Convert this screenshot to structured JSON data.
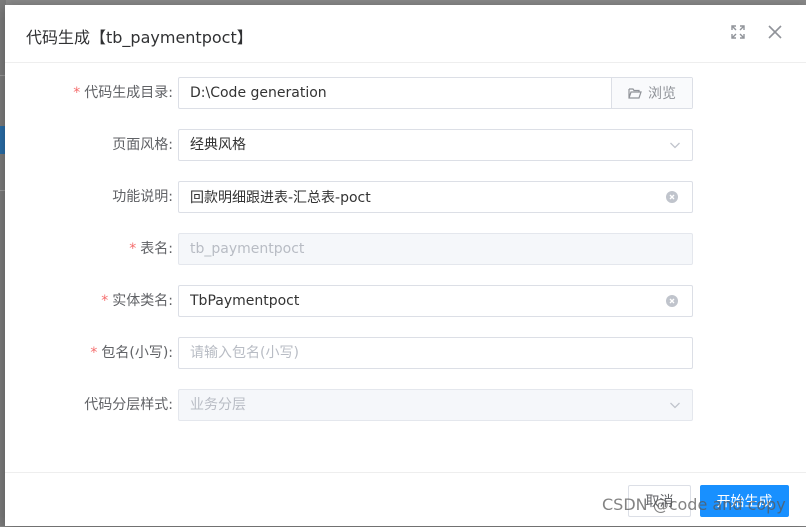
{
  "dialog": {
    "title": "代码生成【tb_paymentpoct】",
    "fullscreen_icon": "fullscreen-icon",
    "close_icon": "close-icon"
  },
  "form": {
    "required_mark": "*",
    "code_dir": {
      "label": "代码生成目录:",
      "value": "D:\\Code generation",
      "browse_label": "浏览",
      "browse_icon": "folder-open-icon"
    },
    "page_style": {
      "label": "页面风格:",
      "value": "经典风格"
    },
    "description": {
      "label": "功能说明:",
      "value": "回款明细跟进表-汇总表-poct"
    },
    "table_name": {
      "label": "表名:",
      "value": "tb_paymentpoct"
    },
    "entity_name": {
      "label": "实体类名:",
      "value": "TbPaymentpoct"
    },
    "package_name": {
      "label": "包名(小写):",
      "value": "",
      "placeholder": "请输入包名(小写)"
    },
    "layer_style": {
      "label": "代码分层样式:",
      "value": "业务分层"
    }
  },
  "footer": {
    "cancel_label": "取消",
    "start_label": "开始生成"
  },
  "watermark": "CSDN @code and copy",
  "colors": {
    "primary": "#1890ff",
    "required": "#f56c6c",
    "label": "#606266",
    "disabled_bg": "#f5f7fa"
  }
}
